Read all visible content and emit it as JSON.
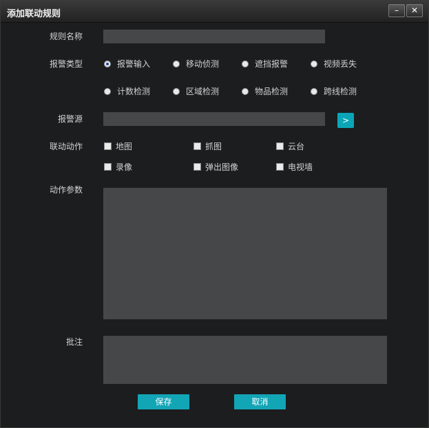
{
  "window": {
    "title": "添加联动规则",
    "minimize_glyph": "–",
    "close_glyph": "✕"
  },
  "form": {
    "rule_name_label": "规则名称",
    "rule_name_value": "",
    "alarm_type_label": "报警类型",
    "alarm_types": [
      {
        "label": "报警输入",
        "checked": true
      },
      {
        "label": "移动侦测",
        "checked": false
      },
      {
        "label": "遮挡报警",
        "checked": false
      },
      {
        "label": "视频丢失",
        "checked": false
      },
      {
        "label": "计数检测",
        "checked": false
      },
      {
        "label": "区域检测",
        "checked": false
      },
      {
        "label": "物品检测",
        "checked": false
      },
      {
        "label": "跨线检测",
        "checked": false
      }
    ],
    "alarm_source_label": "报警源",
    "alarm_source_value": "",
    "alarm_source_button_glyph": ">",
    "linkage_action_label": "联动动作",
    "linkage_actions": [
      {
        "label": "地图",
        "checked": false
      },
      {
        "label": "抓图",
        "checked": false
      },
      {
        "label": "云台",
        "checked": false
      },
      {
        "label": "录像",
        "checked": false
      },
      {
        "label": "弹出图像",
        "checked": false
      },
      {
        "label": "电视墙",
        "checked": false
      }
    ],
    "action_params_label": "动作参数",
    "note_label": "批注",
    "save_label": "保存",
    "cancel_label": "取消"
  },
  "colors": {
    "accent": "#12a5b6",
    "field_bg": "#464749",
    "window_bg": "#1c1d1f"
  }
}
